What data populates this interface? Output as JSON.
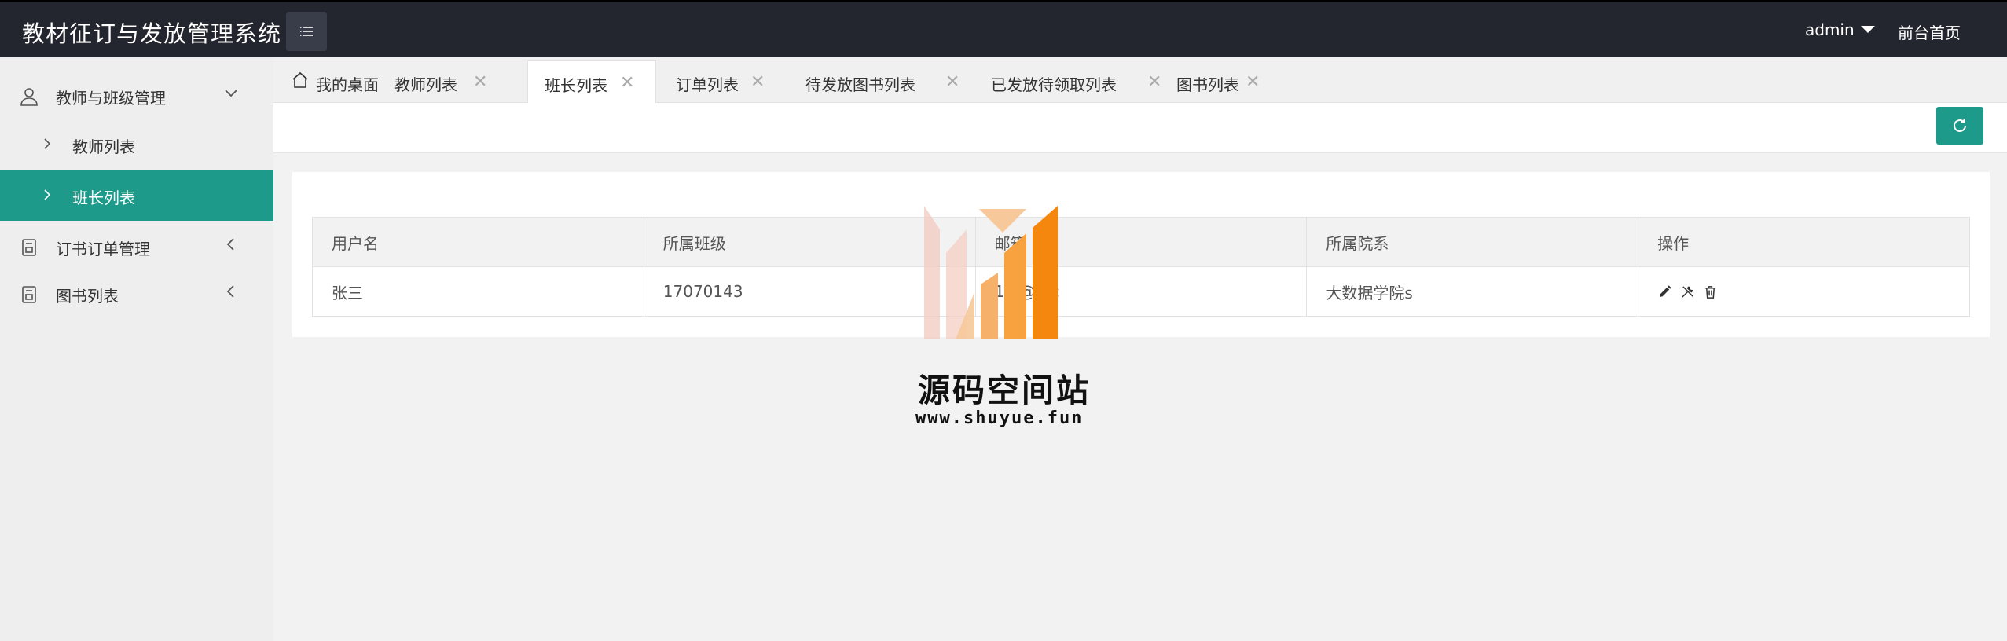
{
  "header": {
    "title": "教材征订与发放管理系统",
    "menu_toggle_icon": "list-icon",
    "user": "admin",
    "home_link": "前台首页",
    "background": "#23262e"
  },
  "sidebar": {
    "groups": [
      {
        "label": "教师与班级管理",
        "icon": "user-icon",
        "expanded": true,
        "items": [
          {
            "label": "教师列表",
            "active": false
          },
          {
            "label": "班长列表",
            "active": true
          }
        ]
      },
      {
        "label": "订书订单管理",
        "icon": "book-icon",
        "expanded": false
      },
      {
        "label": "图书列表",
        "icon": "book-icon",
        "expanded": false
      }
    ],
    "active_color": "#1e9a8a"
  },
  "tabs": [
    {
      "label": "我的桌面",
      "icon": "home-icon",
      "closable": false,
      "active": false
    },
    {
      "label": "教师列表",
      "closable": true,
      "active": false
    },
    {
      "label": "班长列表",
      "closable": true,
      "active": true
    },
    {
      "label": "订单列表",
      "closable": true,
      "active": false
    },
    {
      "label": "待发放图书列表",
      "closable": true,
      "active": false
    },
    {
      "label": "已发放待领取列表",
      "closable": true,
      "active": false
    },
    {
      "label": "图书列表",
      "closable": true,
      "active": false
    }
  ],
  "toolbar": {
    "refresh_icon": "refresh-icon",
    "accent": "#1e9a8a"
  },
  "table": {
    "columns": [
      "用户名",
      "所属班级",
      "邮箱",
      "所属院系",
      "操作"
    ],
    "rows": [
      {
        "username": "张三",
        "class": "17070143",
        "email": "1...@...c",
        "department": "大数据学院s",
        "actions": [
          "edit-icon",
          "tools-icon",
          "delete-icon"
        ]
      }
    ]
  },
  "watermark": {
    "title": "源码空间站",
    "url": "www.shuyue.fun"
  }
}
